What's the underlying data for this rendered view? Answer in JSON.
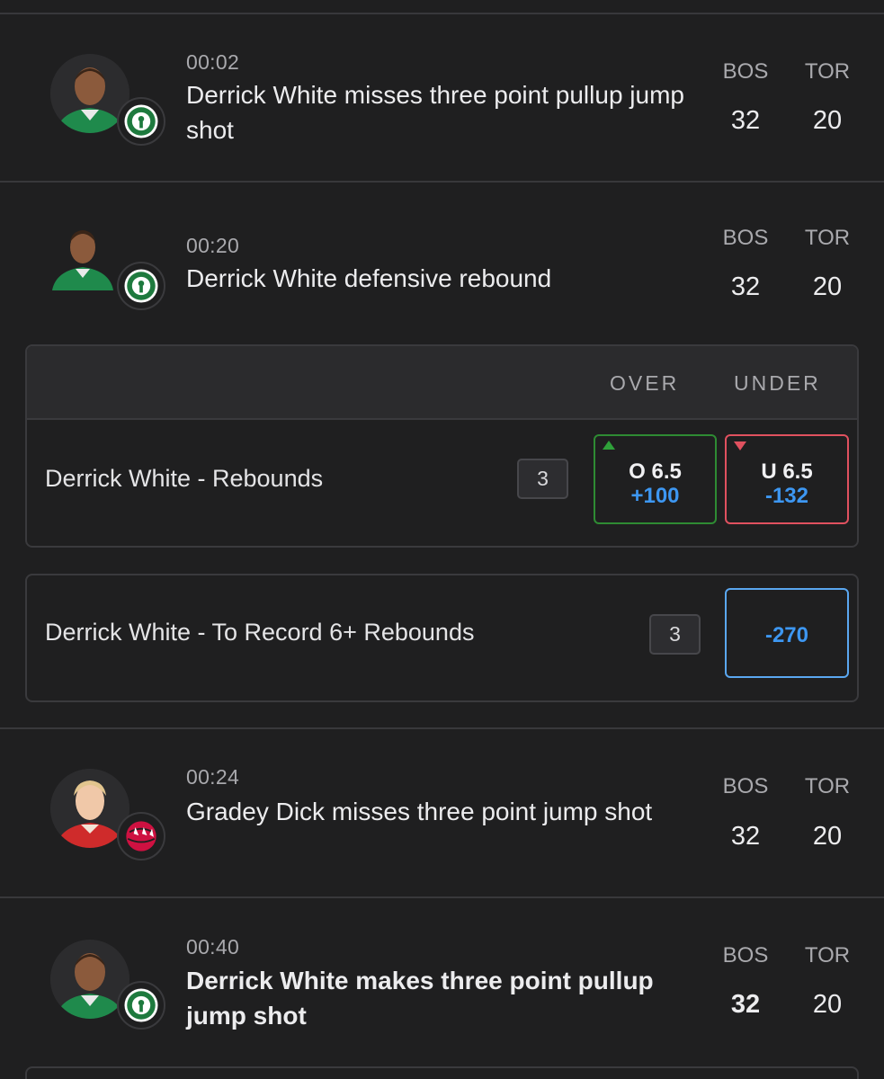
{
  "plays": [
    {
      "clock": "00:02",
      "description": "Derrick White misses three point pullup jump shot",
      "home_team": "BOS",
      "away_team": "TOR",
      "home_score": "32",
      "away_score": "20",
      "player_icon": "player-headshot-icon",
      "team_icon": "celtics-logo-icon",
      "jersey_color": "#1f8a4c"
    },
    {
      "clock": "00:20",
      "description": "Derrick White defensive rebound",
      "home_team": "BOS",
      "away_team": "TOR",
      "home_score": "32",
      "away_score": "20",
      "player_icon": "player-headshot-icon",
      "team_icon": "celtics-logo-icon",
      "jersey_color": "#1f8a4c"
    },
    {
      "clock": "00:24",
      "description": "Gradey Dick misses three point jump shot",
      "home_team": "BOS",
      "away_team": "TOR",
      "home_score": "32",
      "away_score": "20",
      "player_icon": "player-headshot-icon",
      "team_icon": "raptors-logo-icon",
      "jersey_color": "#cf2b2b"
    },
    {
      "clock": "00:40",
      "description": "Derrick White makes three point pullup jump shot",
      "home_team": "BOS",
      "away_team": "TOR",
      "home_score": "32",
      "away_score": "20",
      "player_icon": "player-headshot-icon",
      "team_icon": "celtics-logo-icon",
      "jersey_color": "#1f8a4c"
    }
  ],
  "markets": {
    "over_under": {
      "over_header": "OVER",
      "under_header": "UNDER",
      "label": "Derrick White - Rebounds",
      "count": "3",
      "over": {
        "line": "O 6.5",
        "price": "+100",
        "trend": "up"
      },
      "under": {
        "line": "U 6.5",
        "price": "-132",
        "trend": "down"
      }
    },
    "milestone": {
      "label": "Derrick White - To Record 6+ Rebounds",
      "count": "3",
      "price": "-270"
    }
  },
  "colors": {
    "background": "#1f1f20",
    "odds_blue": "#3d97f2",
    "over_green": "#2e8b33",
    "under_red": "#e0515f"
  }
}
